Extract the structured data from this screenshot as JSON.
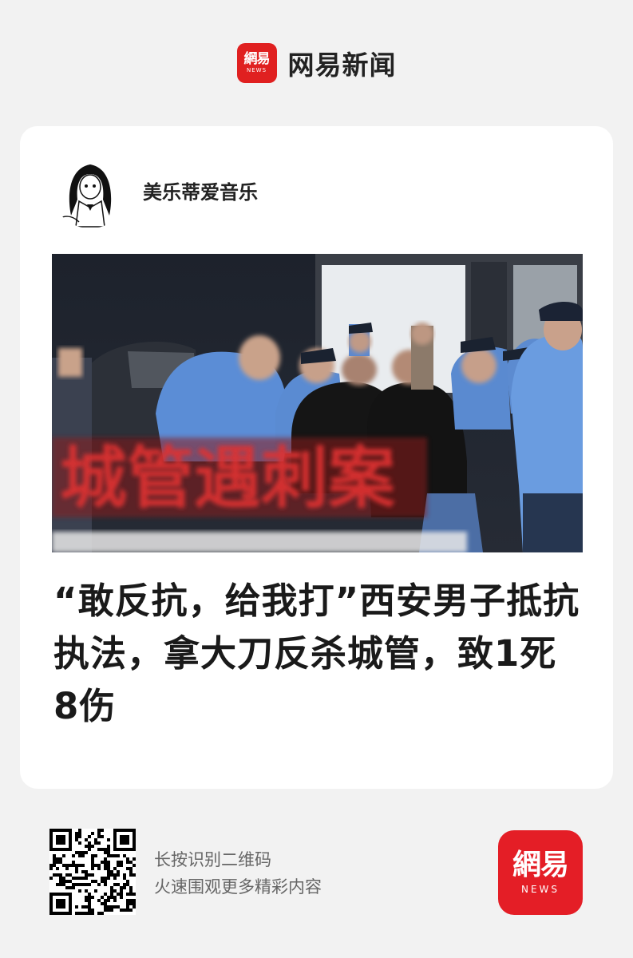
{
  "header": {
    "logo": {
      "text": "網易",
      "sub": "NEWS"
    },
    "brand_name": "网易新闻"
  },
  "card": {
    "author": {
      "name": "美乐蒂爱音乐"
    },
    "cover": {
      "overlay_caption": "城管遇刺案"
    },
    "headline": "“敢反抗，给我打”西安男子抵抗执法，拿大刀反杀城管，致1死8伤"
  },
  "footer": {
    "hint_line1": "长按识别二维码",
    "hint_line2": "火速围观更多精彩内容",
    "logo": {
      "text": "網易",
      "sub": "NEWS"
    }
  },
  "colors": {
    "brand_red": "#e02020",
    "background": "#f2f2f2",
    "card": "#ffffff"
  }
}
